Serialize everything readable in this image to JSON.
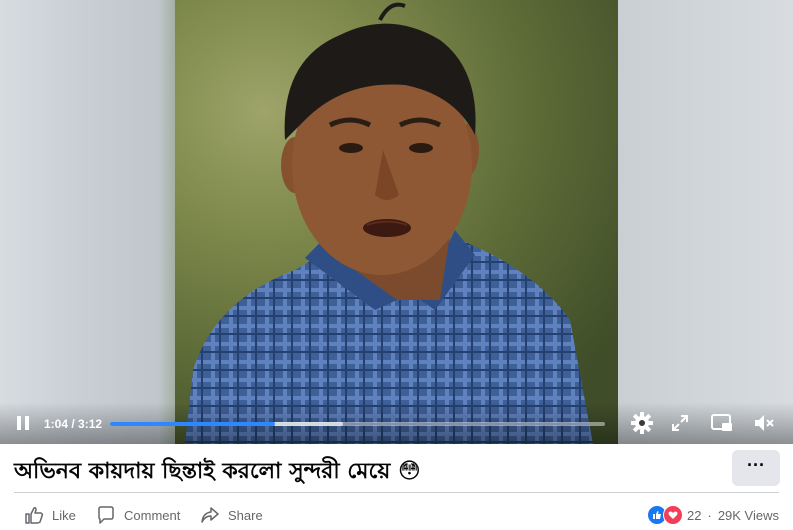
{
  "video": {
    "current_time": "1:04",
    "duration": "3:12",
    "progress_fraction": 0.333,
    "buffered_fraction": 0.47
  },
  "caption": {
    "text": "অভিনব কায়দায় ছিন্তাই করলো সুন্দরী মেয়ে 😳"
  },
  "more_button_label": "···",
  "actions": {
    "like": "Like",
    "comment": "Comment",
    "share": "Share"
  },
  "stats": {
    "reaction_count": "22",
    "separator": "·",
    "views": "29K Views"
  },
  "icons": [
    "pause-icon",
    "settings-icon",
    "fullscreen-icon",
    "pip-icon",
    "muted-speaker-icon",
    "like-icon",
    "comment-icon",
    "share-icon"
  ],
  "colors": {
    "accent": "#2d88ff",
    "like": "#1877f2",
    "love": "#f33e58",
    "secondary_text": "#65676b"
  }
}
